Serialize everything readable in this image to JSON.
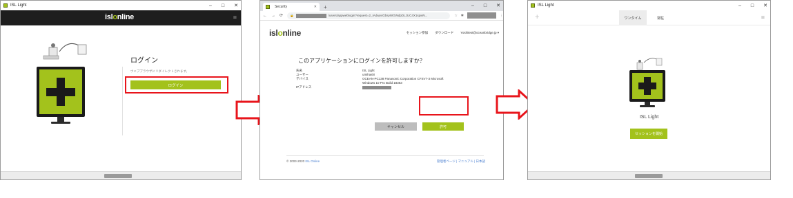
{
  "colors": {
    "brand_green": "#a3c21c",
    "highlight_red": "#e8141b",
    "dark": "#1e1e1e"
  },
  "window1": {
    "title": "ISL Light",
    "controls": [
      "–",
      "□",
      "✕"
    ],
    "logo_isl": "isl",
    "logo_o": "o",
    "logo_rest": "nline",
    "login_title": "ログイン",
    "login_hint": "ウェブブラウザにリダイレクトされます。",
    "login_button": "ログイン",
    "menu_icon": "≡"
  },
  "window2": {
    "tab_title": "Security",
    "new_tab": "+",
    "controls": [
      "–",
      "□",
      "✕"
    ],
    "nav": [
      "←",
      "→",
      "⟳"
    ],
    "url_suffix": "/users/appweblogin?request=2_IAdwy4GbsyWGWdpDLJUC4X1spwN...",
    "logo_isl": "isl",
    "logo_o": "o",
    "logo_rest": "nline",
    "nav_links": [
      "セッション参加",
      "ダウンロード",
      "Yoshitest@oceanbridge.jp ▾"
    ],
    "headline": "このアプリケーションにログインを許可しますか？",
    "fields": [
      {
        "key": "氏名",
        "value": "ISL Light"
      },
      {
        "key": "ユーザー",
        "value": "umihashi"
      },
      {
        "key": "デバイス",
        "value": "OCEAN-PC138 Panasonic Corporation CFSV7-3 Microsoft"
      },
      {
        "key": "",
        "value": "Windows 10 Pro Build 18363"
      },
      {
        "key": "IPアドレス",
        "value": ""
      }
    ],
    "cancel_button": "キャンセル",
    "allow_button": "許可",
    "footer_copyright": "© 2003-2020 ",
    "footer_link": "ISL Online",
    "footer_right": "管理者ページ | マニュアル | 日本語"
  },
  "window3": {
    "title": "ISL Light",
    "controls": [
      "–",
      "□",
      "✕"
    ],
    "plus": "+",
    "tabs": [
      "ワンタイム",
      "常駐"
    ],
    "menu_icon": "≡",
    "app_label": "ISL Light",
    "start_button": "セッションを開始"
  }
}
